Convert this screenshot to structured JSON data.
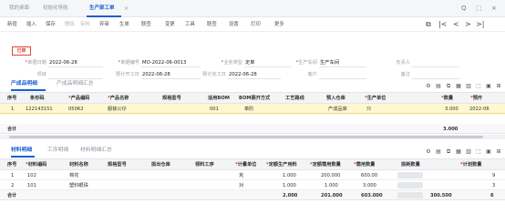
{
  "tabs": [
    {
      "label": "我的桌面"
    },
    {
      "label": "初始化导航"
    },
    {
      "label": "生产部工单"
    }
  ],
  "tab_close": "×",
  "window_controls": [
    "Q",
    "⬚",
    "×"
  ],
  "toolbar": {
    "items": [
      "新增",
      "插入",
      "保存",
      "删除",
      "审核",
      "弃审",
      "生单",
      "联查",
      "变更",
      "工具",
      "联查",
      "设置",
      "打印",
      "更多"
    ],
    "nav_icons": [
      "⧉",
      "|<",
      "<",
      ">",
      ">|"
    ]
  },
  "stamp": "已审",
  "form": {
    "fields": [
      {
        "label": "单据日期",
        "required": true,
        "value": "2022-06-28"
      },
      {
        "label": "单据编号",
        "required": true,
        "value": "MO-2022-06-0013"
      },
      {
        "label": "业务类型",
        "required": true,
        "value": "定单"
      },
      {
        "label": "生产车间",
        "required": true,
        "value": "生产车间"
      },
      {
        "label": "负责人",
        "required": false,
        "value": ""
      },
      {
        "label": "项目",
        "required": false,
        "value": ""
      },
      {
        "label": "预计开工日",
        "required": false,
        "value": "2022-06-28"
      },
      {
        "label": "预计完工日",
        "required": false,
        "value": "2022-06-28"
      },
      {
        "label": "客户",
        "required": false,
        "value": ""
      },
      {
        "label": "备注",
        "required": false,
        "value": ""
      }
    ]
  },
  "grid1": {
    "tabs": [
      {
        "label": "产成品明细"
      },
      {
        "label": "产成品明细汇总"
      }
    ],
    "tool_icons": [
      "⚙",
      "▤",
      "⧉",
      "▦",
      "▥",
      "⬚",
      "▣",
      "⊞"
    ],
    "headers": [
      {
        "label": "序号",
        "required": false
      },
      {
        "label": "条形码",
        "required": false
      },
      {
        "label": "产品编码",
        "required": true
      },
      {
        "label": "产品名称",
        "required": true
      },
      {
        "label": "规格型号",
        "required": false
      },
      {
        "label": "适用BOM",
        "required": false
      },
      {
        "label": "BOM展开方式",
        "required": false
      },
      {
        "label": "工艺路线",
        "required": false
      },
      {
        "label": "预入仓库",
        "required": false
      },
      {
        "label": "生产单位",
        "required": true
      },
      {
        "label": "数量",
        "required": true
      },
      {
        "label": "预开",
        "required": true
      }
    ],
    "rows": [
      [
        "1",
        "122143151",
        "05062",
        "服装公仔",
        "",
        "001",
        "单阶",
        "",
        "产成品库",
        "只",
        "3.000",
        "2022-06"
      ]
    ],
    "total_label": "合计",
    "total_value": "3.000"
  },
  "grid2": {
    "tabs": [
      {
        "label": "材料明细"
      },
      {
        "label": "工序明细"
      },
      {
        "label": "材料明细汇总"
      }
    ],
    "tool_icons": [
      "⚙",
      "▤",
      "⧉",
      "▦",
      "▥",
      "⬚",
      "▣",
      "⊞"
    ],
    "headers": [
      {
        "label": "序号",
        "required": false
      },
      {
        "label": "材料编码",
        "required": true
      },
      {
        "label": "材料名称",
        "required": false
      },
      {
        "label": "规格型号",
        "required": false
      },
      {
        "label": "损出仓库",
        "required": false
      },
      {
        "label": "领料工序",
        "required": false
      },
      {
        "label": "计量单位",
        "required": true
      },
      {
        "label": "定额生产用料",
        "required": true
      },
      {
        "label": "定额需用数量",
        "required": true
      },
      {
        "label": "需用数量",
        "required": true
      },
      {
        "label": "损耗数量",
        "required": false
      },
      {
        "label": "计划数量",
        "required": true
      }
    ],
    "rows": [
      [
        "1",
        "102",
        "棉花",
        "",
        "",
        "",
        "克",
        "1.000",
        "200.000",
        "600.00",
        "",
        "9"
      ],
      [
        "2",
        "101",
        "塑料眼珠",
        "",
        "",
        "",
        "对",
        "1.000",
        "1.000",
        "3.000",
        "",
        "3"
      ]
    ],
    "totals": {
      "label": "合计",
      "v1": "2.000",
      "v2": "201.000",
      "v3": "603.000",
      "v4": "300.500",
      "v5": "6"
    }
  },
  "colors": {
    "accent": "#1a5fd0",
    "selected_row": "#fff8cf",
    "required": "#e2453a"
  }
}
